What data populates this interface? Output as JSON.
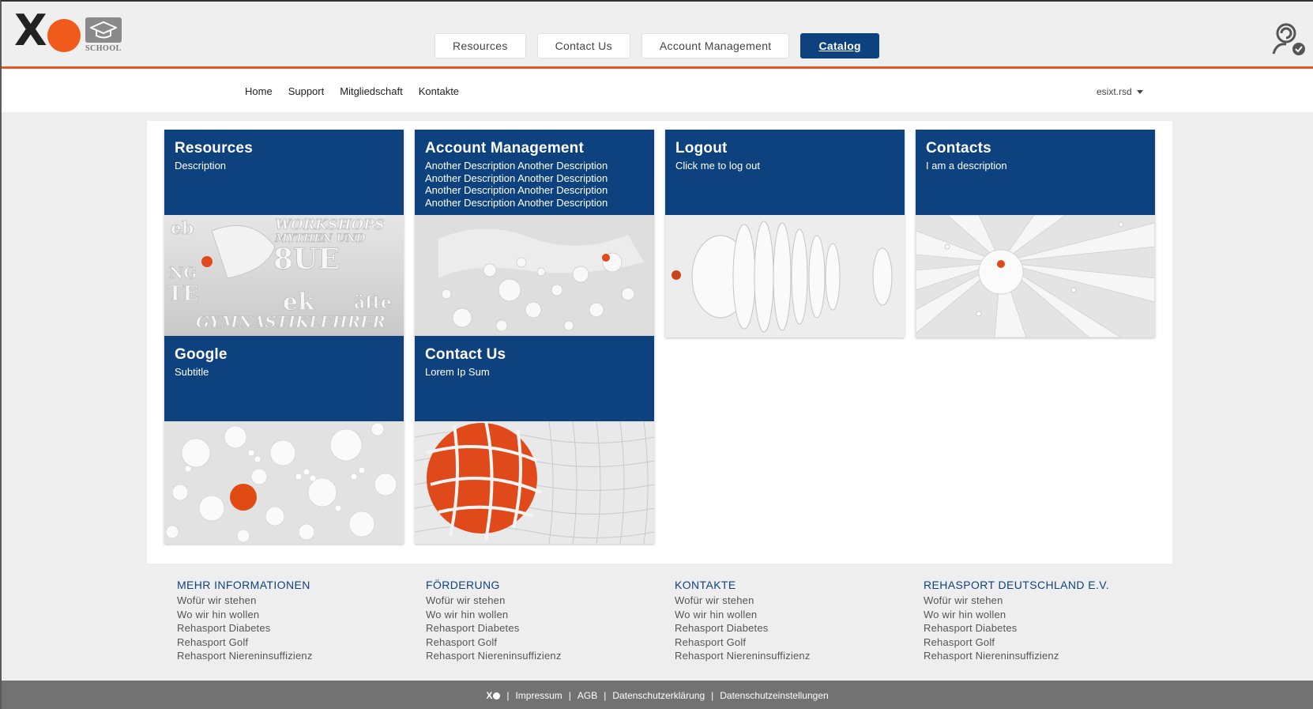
{
  "header": {
    "logo_text": "SCHOOL",
    "nav": [
      {
        "label": "Resources",
        "active": false
      },
      {
        "label": "Contact Us",
        "active": false
      },
      {
        "label": "Account Management",
        "active": false
      },
      {
        "label": "Catalog",
        "active": true
      }
    ]
  },
  "subnav": {
    "links": [
      "Home",
      "Support",
      "Mitgliedschaft",
      "Kontakte"
    ],
    "user": "esixt.rsd"
  },
  "tiles": [
    {
      "title": "Resources",
      "description": "Description",
      "image": "workshop-letters"
    },
    {
      "title": "Account Management",
      "description": "Another Description Another Description Another Description Another Description Another Description Another Description Another Description Another Description",
      "image": "white-map-spheres"
    },
    {
      "title": "Logout",
      "description": "Click me to log out",
      "image": "sliced-sphere"
    },
    {
      "title": "Contacts",
      "description": "I am a description",
      "image": "sunburst-folds"
    },
    {
      "title": "Google",
      "description": "Subtitle",
      "image": "white-balls-orange"
    },
    {
      "title": "Contact Us",
      "description": "Lorem Ip Sum",
      "image": "orange-sphere-mesh"
    }
  ],
  "footer": {
    "columns": [
      {
        "heading": "MEHR INFORMATIONEN",
        "links": [
          "Wofür wir stehen",
          "Wo wir hin wollen",
          "Rehasport Diabetes",
          "Rehasport Golf",
          "Rehasport Niereninsuffizienz"
        ]
      },
      {
        "heading": "FÖRDERUNG",
        "links": [
          "Wofür wir stehen",
          "Wo wir hin wollen",
          "Rehasport Diabetes",
          "Rehasport Golf",
          "Rehasport Niereninsuffizienz"
        ]
      },
      {
        "heading": "KONTAKTE",
        "links": [
          "Wofür wir stehen",
          "Wo wir hin wollen",
          "Rehasport Diabetes",
          "Rehasport Golf",
          "Rehasport Niereninsuffizienz"
        ]
      },
      {
        "heading": "REHASPORT DEUTSCHLAND E.V.",
        "links": [
          "Wofür wir stehen",
          "Wo wir hin wollen",
          "Rehasport Diabetes",
          "Rehasport Golf",
          "Rehasport Niereninsuffizienz"
        ]
      }
    ],
    "bottom_links": [
      "Impressum",
      "AGB",
      "Datenschutzerklärung",
      "Datenschutzeinstellungen"
    ]
  },
  "colors": {
    "brand_blue": "#0d427f",
    "accent_orange": "#e4582a"
  }
}
